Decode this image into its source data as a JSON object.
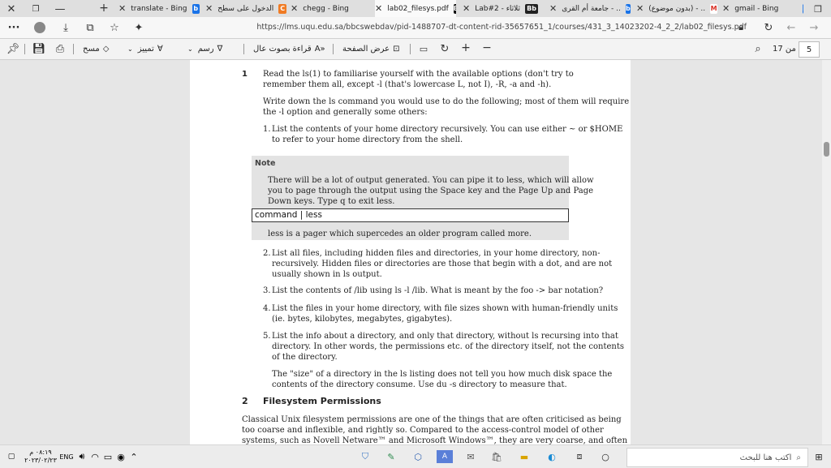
{
  "tabs": [
    {
      "label": "translate - Bing",
      "fav": "b"
    },
    {
      "label": "الدخول على سطح",
      "fav": "C"
    },
    {
      "label": "chegg - Bing",
      "fav": "b"
    },
    {
      "label": "lab02_filesys.pdf",
      "fav": "Bb",
      "active": true
    },
    {
      "label": "Lab#2 - ثلاثاء",
      "fav": "Bb"
    },
    {
      "label": "جامعة أم القرى - ..",
      "fav": "b"
    },
    {
      "label": "(بدون موضوع) - ..",
      "fav": "M"
    },
    {
      "label": "gmail - Bing",
      "fav": "b"
    }
  ],
  "address": {
    "url": "https://lms.uqu.edu.sa/bbcswebdav/pid-1488707-dt-content-rid-35657651_1/courses/431_3_14023202-4_2_2/lab02_filesys.pdf"
  },
  "pdf_toolbar": {
    "page_number": "5",
    "page_of": "من 17",
    "fit_label": "عرض الصفحة",
    "read_aloud": "قراءة بصوت عال",
    "draw": "رسم",
    "highlight": "تمييز",
    "erase": "مسح"
  },
  "document": {
    "s1_num": "1",
    "s1_l1": "Read the ls(1) to familiarise yourself with the available options (don't try to",
    "s1_l2": "remember them all, except -l (that's lowercase L, not I), -R, -a and -h).",
    "p2_l1": "Write down the ls command you would use to do the following; most of them will require",
    "p2_l2": "the -l option and generally some others:",
    "i1_num": "1.",
    "i1_l1": "List the contents of your home directory recursively. You can use either ~ or $HOME",
    "i1_l2": "to refer to your home directory from the shell.",
    "note_title": "Note",
    "note_l1": "There will be a lot of output generated. You can pipe it to less, which will allow",
    "note_l2": "you to page through the output using the Space key and the Page Up and Page",
    "note_l3": "Down keys. Type q to exit less.",
    "note_cmd": "command | less",
    "note_after": "less is a pager which supercedes an older program called more.",
    "i2_num": "2.",
    "i2_l1": "List all files, including hidden files and directories, in your home directory, non-",
    "i2_l2": "recursively. Hidden files or directories are those that begin with a dot, and are not",
    "i2_l3": "usually shown in ls output.",
    "i3_num": "3.",
    "i3_l1": "List the contents of /lib using ls -l /lib. What is meant by the foo -> bar notation?",
    "i4_num": "4.",
    "i4_l1": "List the files in your home directory, with file sizes shown with human-friendly units",
    "i4_l2": "(ie. bytes, kilobytes, megabytes, gigabytes).",
    "i5_num": "5.",
    "i5_l1": "List the info about a directory, and only that directory, without ls recursing into that",
    "i5_l2": "directory. In other words, the permissions etc. of the directory itself, not the contents",
    "i5_l3": "of the directory.",
    "i5b_l1": "The \"size\" of a directory in the ls listing does not tell you how much disk space the",
    "i5b_l2": "contents of the directory consume. Use du -s directory to measure that.",
    "s2_num": "2",
    "s2_title": "Filesystem Permissions",
    "s2_l1": "Classical Unix filesystem permissions are one of the things that are often criticised as being",
    "s2_l2": "too coarse and inflexible, and rightly so. Compared to the access-control model of other",
    "s2_l3": "systems, such as Novell Netware™ and Microsoft Windows™, they are very coarse, and often"
  },
  "taskbar": {
    "search_placeholder": "اكتب هنا للبحث",
    "time": "٠٨:١٩ م",
    "date": "٢٠٢٣/٠٢/٢٣",
    "lang": "ENG"
  }
}
